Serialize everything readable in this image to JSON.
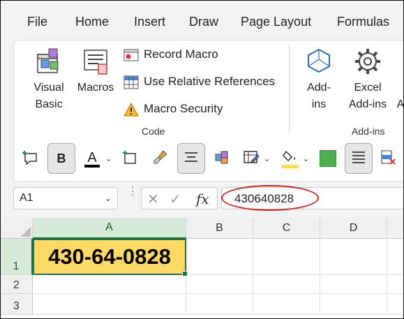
{
  "tabs": [
    "File",
    "Home",
    "Insert",
    "Draw",
    "Page Layout",
    "Formulas"
  ],
  "ribbon": {
    "visual_basic": [
      "Visual",
      "Basic"
    ],
    "macros": "Macros",
    "record_macro": "Record Macro",
    "use_relative": "Use Relative References",
    "macro_security": "Macro Security",
    "code_group": "Code",
    "addins": [
      "Add-",
      "ins"
    ],
    "excel_addins": [
      "Excel",
      "Add-ins"
    ],
    "addins_group": "Add-ins",
    "truncated_next": "A"
  },
  "qat": {
    "bold_label": "B",
    "font_color_label": "A",
    "font_color": "#000000",
    "fill_color": "#ffd966",
    "green_swatch": "#4caf50"
  },
  "name_box": {
    "value": "A1"
  },
  "fx_label": "fx",
  "formula_bar": {
    "value": "430640828"
  },
  "grid": {
    "columns": [
      "A",
      "B",
      "C",
      "D"
    ],
    "rows": [
      "1",
      "2",
      "3"
    ],
    "a1_display": "430-64-0828",
    "a1_fill": "#ffd966",
    "selection_color": "#217346"
  },
  "annotation_color": "#d62020"
}
